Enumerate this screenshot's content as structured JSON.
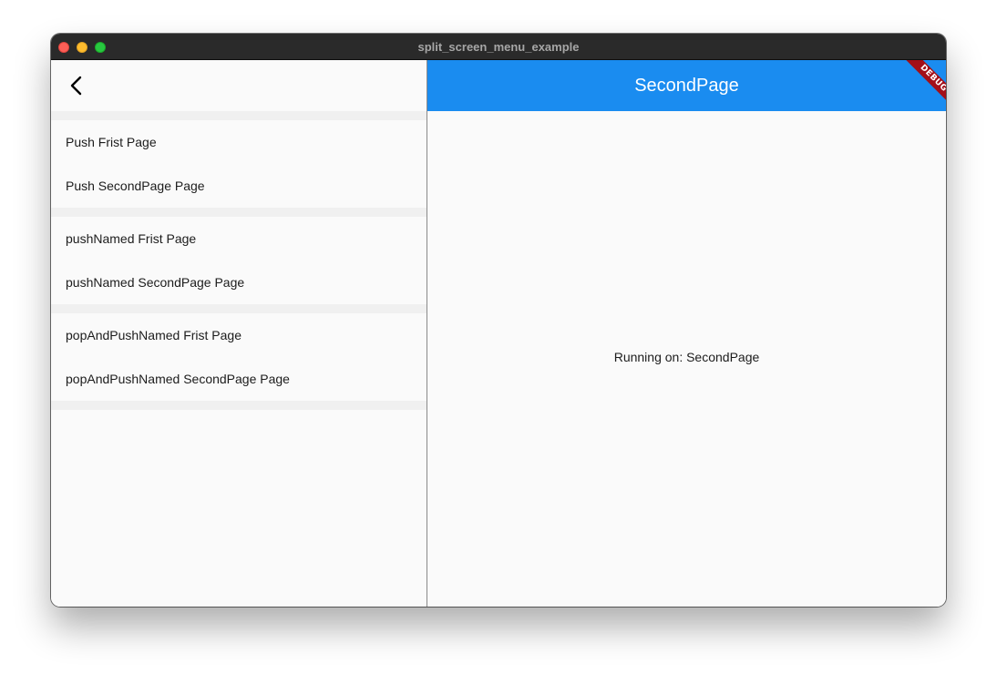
{
  "window": {
    "title": "split_screen_menu_example"
  },
  "left_pane": {
    "back_icon": "chevron-left-icon",
    "groups": [
      [
        "Push Frist Page",
        "Push SecondPage Page"
      ],
      [
        "pushNamed Frist Page",
        "pushNamed SecondPage Page"
      ],
      [
        "popAndPushNamed Frist Page",
        "popAndPushNamed SecondPage Page"
      ]
    ]
  },
  "right_pane": {
    "title": "SecondPage",
    "body_text": "Running on: SecondPage",
    "debug_banner": "DEBUG",
    "appbar_color": "#1a8cf0"
  },
  "colors": {
    "debug_banner": "#a30f18",
    "close": "#fe5f57",
    "minimize": "#febc2e",
    "maximize": "#28c840"
  }
}
